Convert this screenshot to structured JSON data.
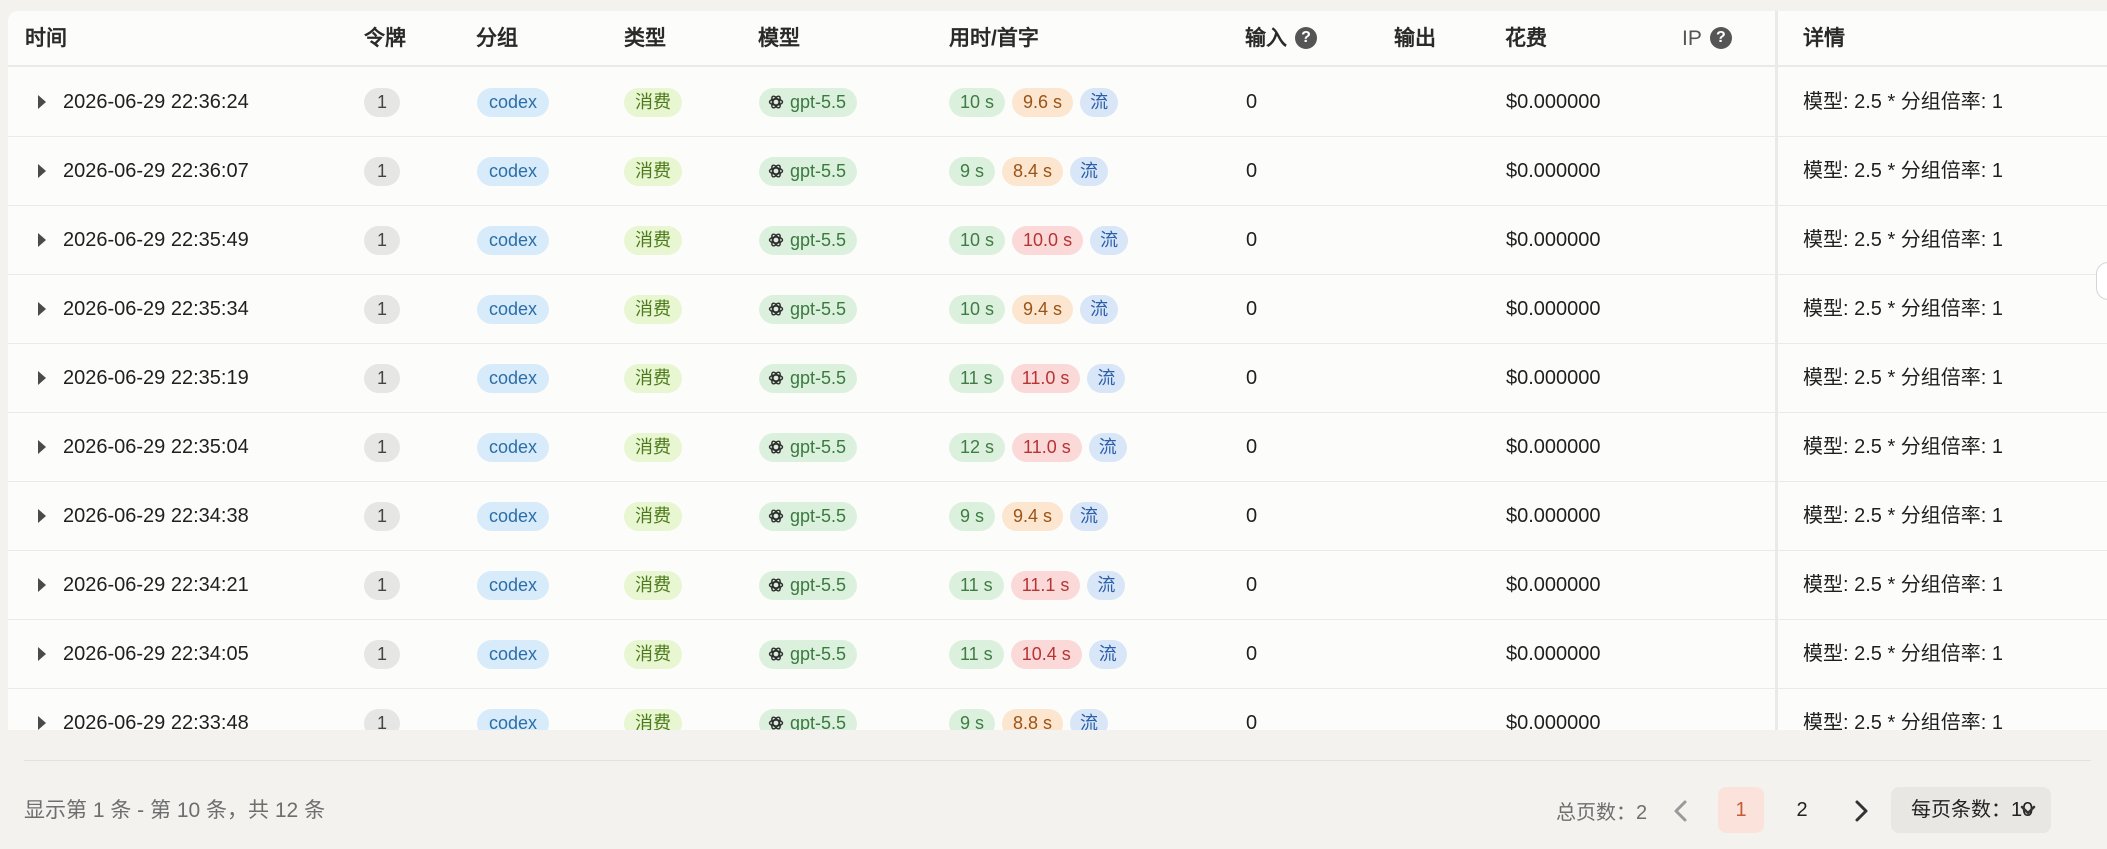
{
  "table": {
    "columns": {
      "time": "时间",
      "token": "令牌",
      "group": "分组",
      "type": "类型",
      "model": "模型",
      "timing": "用时/首字",
      "input": "输入",
      "output": "输出",
      "cost": "花费",
      "ip": "IP",
      "detail": "详情"
    },
    "help_glyph": "?",
    "rows": [
      {
        "time": "2026-06-29 22:36:24",
        "token": "1",
        "group": "codex",
        "type": "消费",
        "model": "gpt-5.5",
        "duration": "10 s",
        "first": "9.6 s",
        "first_level": "orange",
        "stream": "流",
        "input": "0",
        "output": "",
        "cost": "$0.000000",
        "ip": "",
        "detail": "模型: 2.5 * 分组倍率: 1"
      },
      {
        "time": "2026-06-29 22:36:07",
        "token": "1",
        "group": "codex",
        "type": "消费",
        "model": "gpt-5.5",
        "duration": "9 s",
        "first": "8.4 s",
        "first_level": "orange",
        "stream": "流",
        "input": "0",
        "output": "",
        "cost": "$0.000000",
        "ip": "",
        "detail": "模型: 2.5 * 分组倍率: 1"
      },
      {
        "time": "2026-06-29 22:35:49",
        "token": "1",
        "group": "codex",
        "type": "消费",
        "model": "gpt-5.5",
        "duration": "10 s",
        "first": "10.0 s",
        "first_level": "red",
        "stream": "流",
        "input": "0",
        "output": "",
        "cost": "$0.000000",
        "ip": "",
        "detail": "模型: 2.5 * 分组倍率: 1"
      },
      {
        "time": "2026-06-29 22:35:34",
        "token": "1",
        "group": "codex",
        "type": "消费",
        "model": "gpt-5.5",
        "duration": "10 s",
        "first": "9.4 s",
        "first_level": "orange",
        "stream": "流",
        "input": "0",
        "output": "",
        "cost": "$0.000000",
        "ip": "",
        "detail": "模型: 2.5 * 分组倍率: 1"
      },
      {
        "time": "2026-06-29 22:35:19",
        "token": "1",
        "group": "codex",
        "type": "消费",
        "model": "gpt-5.5",
        "duration": "11 s",
        "first": "11.0 s",
        "first_level": "red",
        "stream": "流",
        "input": "0",
        "output": "",
        "cost": "$0.000000",
        "ip": "",
        "detail": "模型: 2.5 * 分组倍率: 1"
      },
      {
        "time": "2026-06-29 22:35:04",
        "token": "1",
        "group": "codex",
        "type": "消费",
        "model": "gpt-5.5",
        "duration": "12 s",
        "first": "11.0 s",
        "first_level": "red",
        "stream": "流",
        "input": "0",
        "output": "",
        "cost": "$0.000000",
        "ip": "",
        "detail": "模型: 2.5 * 分组倍率: 1"
      },
      {
        "time": "2026-06-29 22:34:38",
        "token": "1",
        "group": "codex",
        "type": "消费",
        "model": "gpt-5.5",
        "duration": "9 s",
        "first": "9.4 s",
        "first_level": "orange",
        "stream": "流",
        "input": "0",
        "output": "",
        "cost": "$0.000000",
        "ip": "",
        "detail": "模型: 2.5 * 分组倍率: 1"
      },
      {
        "time": "2026-06-29 22:34:21",
        "token": "1",
        "group": "codex",
        "type": "消费",
        "model": "gpt-5.5",
        "duration": "11 s",
        "first": "11.1 s",
        "first_level": "red",
        "stream": "流",
        "input": "0",
        "output": "",
        "cost": "$0.000000",
        "ip": "",
        "detail": "模型: 2.5 * 分组倍率: 1"
      },
      {
        "time": "2026-06-29 22:34:05",
        "token": "1",
        "group": "codex",
        "type": "消费",
        "model": "gpt-5.5",
        "duration": "11 s",
        "first": "10.4 s",
        "first_level": "red",
        "stream": "流",
        "input": "0",
        "output": "",
        "cost": "$0.000000",
        "ip": "",
        "detail": "模型: 2.5 * 分组倍率: 1"
      },
      {
        "time": "2026-06-29 22:33:48",
        "token": "1",
        "group": "codex",
        "type": "消费",
        "model": "gpt-5.5",
        "duration": "9 s",
        "first": "8.8 s",
        "first_level": "orange",
        "stream": "流",
        "input": "0",
        "output": "",
        "cost": "$0.000000",
        "ip": "",
        "detail": "模型: 2.5 * 分组倍率: 1"
      }
    ]
  },
  "footer": {
    "range_text": "显示第 1 条 - 第 10 条，共 12 条",
    "total_pages_text": "总页数：2",
    "pages": [
      "1",
      "2"
    ],
    "current_page": "1",
    "page_size_text": "每页条数：10"
  },
  "colors": {
    "accent": "#c75a3a",
    "duration_green": "#dcf1dd",
    "first_orange": "#fde6cf",
    "first_red": "#fbd9d9"
  },
  "icons": {
    "expand": "caret-right-icon",
    "model": "openai-icon",
    "prev": "chevron-left-icon",
    "next": "chevron-right-icon",
    "page_size": "chevron-down-icon",
    "help": "question-circle-icon"
  }
}
